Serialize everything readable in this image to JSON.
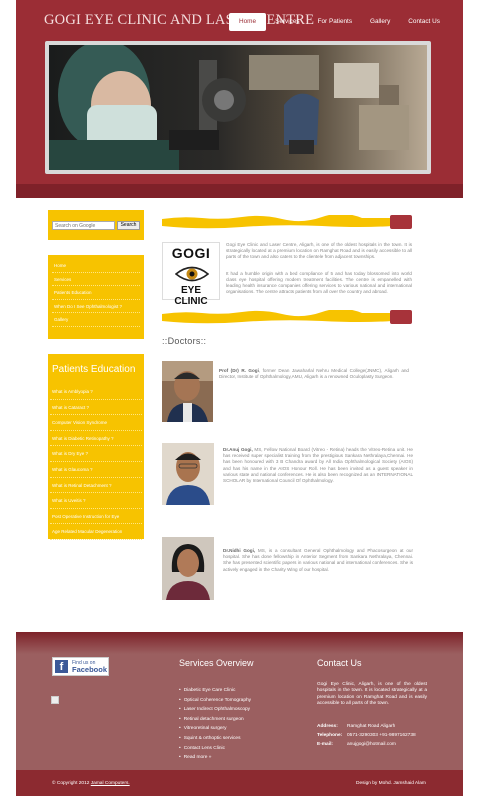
{
  "header": {
    "site_title": "GOGI EYE CLINIC AND LASER CENTRE",
    "nav": [
      "Home",
      "Services",
      "For Patients",
      "Gallery",
      "Contact Us"
    ],
    "active_nav": "Home",
    "accent_color": "#9b2d35"
  },
  "search": {
    "placeholder": "Search on Google",
    "button_label": "Search"
  },
  "menu": {
    "items": [
      "Home",
      "Services",
      "Patients Education",
      "When Do I See Ophthalmologist ?",
      "Gallery"
    ]
  },
  "patients_education": {
    "title": "Patients Education",
    "items": [
      "What is Amblyopia ?",
      "What is Cataract ?",
      "Computer Vision Syndrome",
      "What is Diabetic Retinopathy ?",
      "What is Dry Eye ?",
      "What is Glaucoma ?",
      "What is Retinal Detachment ?",
      "What is Uveitis ?",
      "Post Operative Instruction for Eye",
      "Age Related Macular Degeneration"
    ]
  },
  "about": {
    "logo_top": "GOGI",
    "logo_bottom": "EYE CLINIC",
    "paragraph1": "Gogi Eye Clinic and Laser Centre, Aligarh, is one of the oldest hospitals in the town. It is strategically located at a premium location on Ramghat Road and is easily accessible to all parts of the town and also caters to the clientele from adjacent townships.",
    "paragraph2": "It had a humble origin with a bed compliance of 5 and has today blossomed into world class eye hospital offering modern treatment facilities. The centre is empanelled with leading health insurance companies offering services to various national and international organisations. The centre attracts patients from all over the country and abroad."
  },
  "doctors": {
    "heading": "::Doctors::",
    "list": [
      {
        "name": "Prof (Dr) R. Gogi",
        "bio": ", former Dean Jawaharlal Nehru Medical College(JNMC), Aligarh and Director, Institute of Ophthalmology,AMU, Aligarh is a renowned Oculoplasty Surgeon."
      },
      {
        "name": "Dr.Anuj Gogi,",
        "bio": " MS, Fellow National Board (Vitreo - Retina) heads the Vitreo-Retina unit. He has received super specialist training from the prestigious Sankara Nethralaya,Chennai. He has been honoured with 3 B Chandra award by All India Ophthalmological Society (AIOS) and has his name in the AIOS Honour Roll. He has been invited as a guest speaker in various state and national conferences. He is also been recognized as an INTERNATIONAL SCHOLAR by International Council Of Ophthalmology."
      },
      {
        "name": "Dr.Nidhi Gogi,",
        "bio": " MS, is a consultant General Ophthalmology and Phacosurgeon at our hospital. She has done fellowship in Anterior Segment from Sankara Nethralaya, Chennai. She has presented scientific papers in various national and international conferences. She is actively engaged in the Charity Wing of our hospital."
      }
    ]
  },
  "footer": {
    "fb_line1": "Find us on",
    "fb_line2": "Facebook",
    "services_heading": "Services Overview",
    "services": [
      "Diabetic Eye Care Clinic",
      "Optical Coherence Tomography",
      "Laser Indirect Ophthalmoscopy",
      "Retinal detachment surgeon",
      "Vitreoretinal surgery",
      "Squint & orthoptic services",
      "Contact Lens Clinic",
      "Read more »"
    ],
    "contact_heading": "Contact Us",
    "contact_text": "Gogi Eye Clinic, Aligarh, is one of the oldest hospitals in the town. It is located strategically at a premium location on Ramghat Road and is easily accessible to all parts of the town.",
    "address_label": "Address:",
    "address_value": "Ramghat Road Aligarh",
    "telephone_label": "Telephone:",
    "telephone_value": "0571-3290303 +91-9897162738",
    "email_label": "E-mail:",
    "email_value": "anujgogi@hotmail.com",
    "copyright_prefix": "© Copyright 2012",
    "copyright_link": "Jamal Computers.",
    "designer": "Design by Mohd. Jamshaid Alam",
    "bg_color": "#9b5f60"
  }
}
